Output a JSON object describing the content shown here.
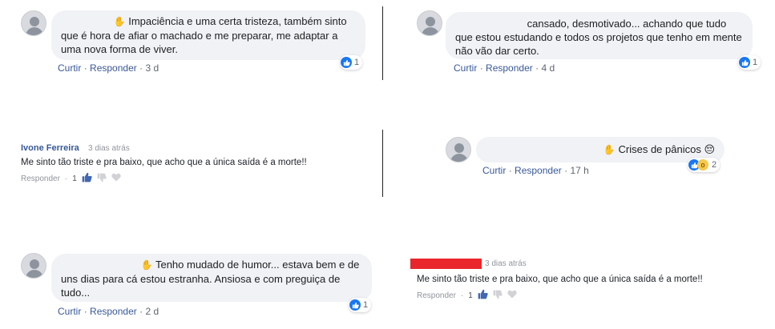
{
  "comment1": {
    "text": "Impaciência e uma certa tristeza, também sinto que é hora de afiar o machado e me preparar, me adaptar a uma nova forma de viver.",
    "like": "Curtir",
    "reply": "Responder",
    "time": "3 d",
    "reaction_count": "1"
  },
  "comment2": {
    "text": "cansado, desmotivado... achando que tudo que estou estudando e todos os projetos que tenho em mente não vão dar certo.",
    "like": "Curtir",
    "reply": "Responder",
    "time": "4 d",
    "reaction_count": "1"
  },
  "comment3": {
    "name": "Ivone Ferreira",
    "time": "3 dias atrás",
    "text": "Me sinto tão triste e pra baixo, que acho que a única saída é a morte!!",
    "reply": "Responder",
    "count": "1"
  },
  "comment4": {
    "text": "Crises de pânicos 😔",
    "like": "Curtir",
    "reply": "Responder",
    "time": "17 h",
    "reaction_count": "2"
  },
  "comment5": {
    "text": "Tenho mudado de humor... estava bem e de uns dias para cá estou estranha. Ansiosa e com preguiça de tudo...",
    "like": "Curtir",
    "reply": "Responder",
    "time": "2 d",
    "reaction_count": "1"
  },
  "comment6": {
    "time": "3 dias atrás",
    "text": "Me sinto tão triste e pra baixo, que acho que a única saída é a morte!!",
    "reply": "Responder",
    "count": "1"
  },
  "colors": {
    "link": "#385898",
    "like_blue": "#1877f2",
    "bubble": "#f0f2f5",
    "redaction_red": "#e8262b"
  },
  "icons": [
    "waving-hand-icon",
    "like-reaction-icon",
    "wow-reaction-icon",
    "thumbs-up-icon",
    "thumbs-down-icon",
    "heart-icon"
  ]
}
